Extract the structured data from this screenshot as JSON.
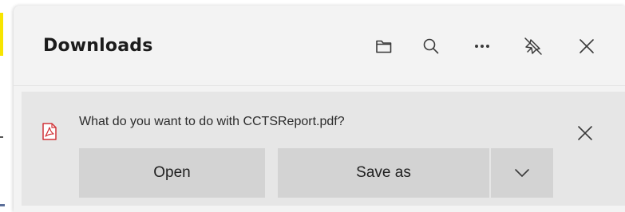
{
  "panel": {
    "title": "Downloads",
    "icons": [
      "folder-icon",
      "search-icon",
      "more-icon",
      "pin-icon",
      "close-icon"
    ]
  },
  "download_item": {
    "file_icon": "pdf-icon",
    "message": "What do you want to do with CCTSReport.pdf?",
    "open_label": "Open",
    "save_as_label": "Save as",
    "more_options_icon": "chevron-down-icon",
    "dismiss_icon": "close-icon"
  },
  "colors": {
    "panel_bg": "#f3f3f3",
    "item_bg": "#e6e6e6",
    "button_bg": "#d3d3d3",
    "pdf_red": "#d13438",
    "accent_strip": "#f7e500"
  }
}
